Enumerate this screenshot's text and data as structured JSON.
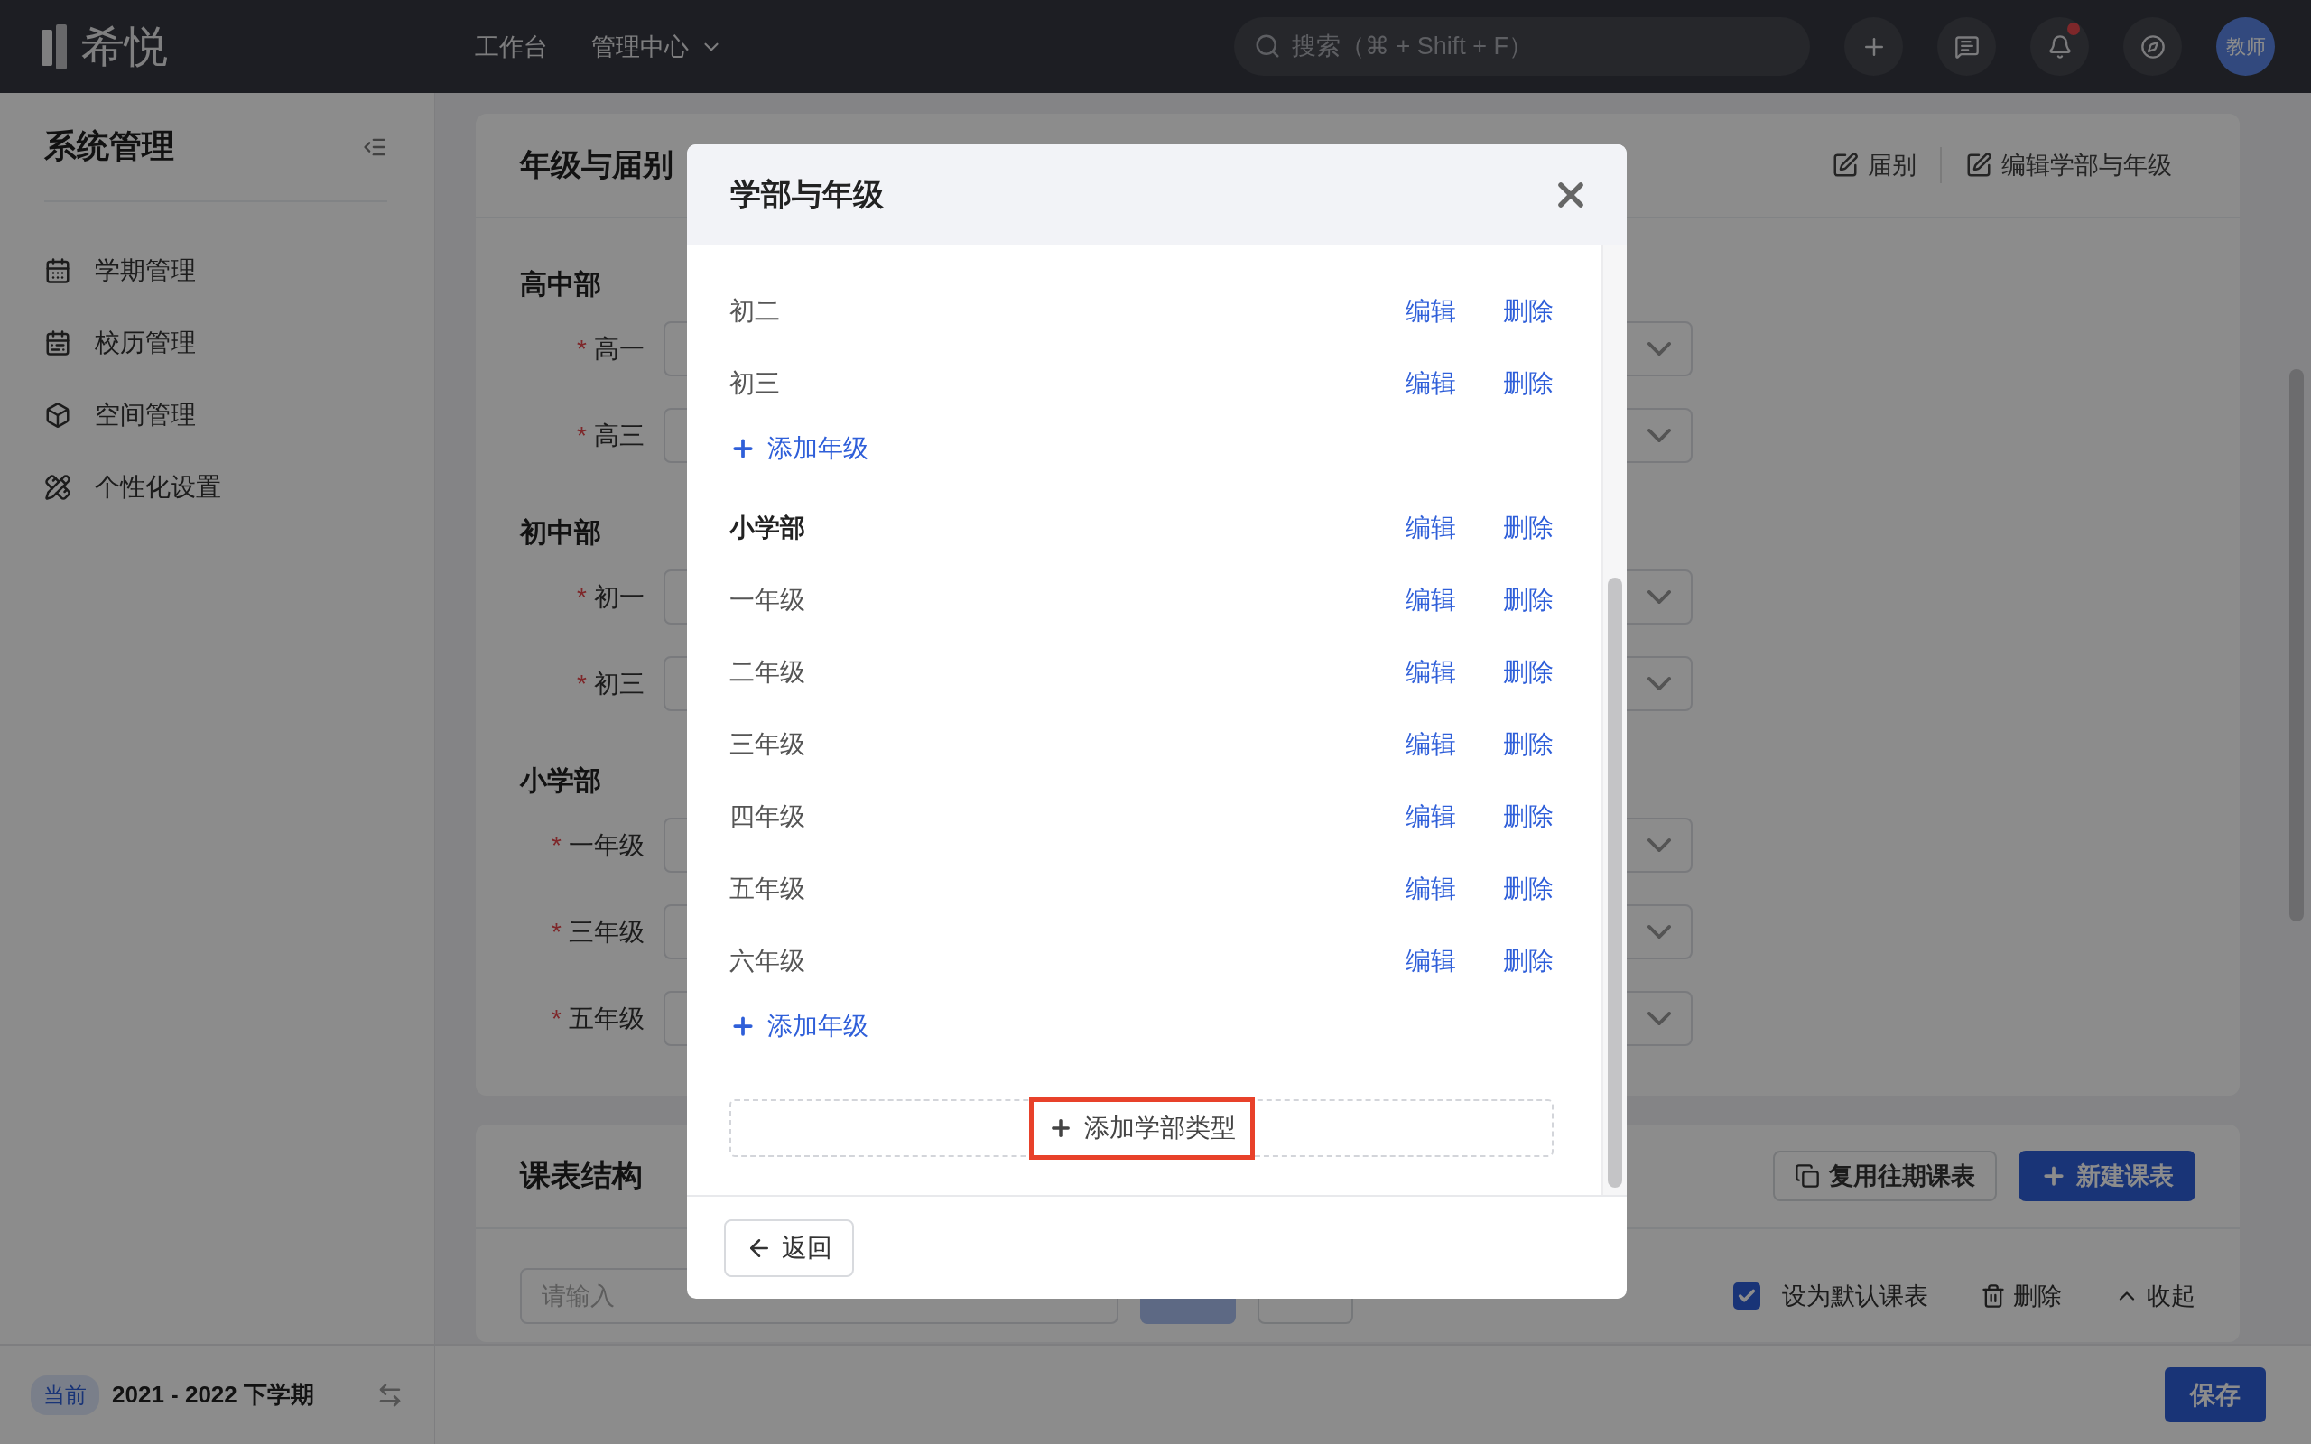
{
  "top_bar": {
    "logo": "希悦",
    "nav": [
      {
        "label": "工作台",
        "dropdown": false
      },
      {
        "label": "管理中心",
        "dropdown": true
      }
    ],
    "search": {
      "placeholder": "搜索（⌘ + Shift + F）"
    },
    "has_notification": true,
    "avatar": "教师"
  },
  "sidebar": {
    "title": "系统管理",
    "items": [
      {
        "label": "学期管理",
        "kind": "term",
        "selected": false
      },
      {
        "label": "校历管理",
        "kind": "calendar",
        "selected": false
      },
      {
        "label": "空间管理",
        "kind": "space",
        "selected": false
      },
      {
        "label": "个性化设置",
        "kind": "custom",
        "selected": false
      }
    ],
    "current_term": {
      "badge": "当前",
      "label": "2021 - 2022 下学期"
    }
  },
  "grades_card": {
    "title": "年级与届别",
    "actions": [
      "届别",
      "编辑学部与年级"
    ],
    "sections": [
      {
        "title": "高中部",
        "fields": [
          {
            "mark": "*",
            "label": "高一"
          },
          {
            "mark": "*",
            "label": "高三"
          }
        ]
      },
      {
        "title": "初中部",
        "fields": [
          {
            "mark": "*",
            "label": "初一"
          },
          {
            "mark": "*",
            "label": "初三"
          }
        ]
      },
      {
        "title": "小学部",
        "fields": [
          {
            "mark": "*",
            "label": "一年级"
          },
          {
            "mark": "*",
            "label": "三年级"
          },
          {
            "mark": "*",
            "label": "五年级"
          }
        ]
      }
    ]
  },
  "schedule_card": {
    "title": "课表结构",
    "actions": [
      {
        "label": "复用往期课表",
        "kind": "outline"
      },
      {
        "label": "新建课表",
        "kind": "primary"
      }
    ],
    "name_input": {
      "placeholder": "请输入"
    },
    "confirm": {
      "disabled": true
    },
    "default_checkbox": {
      "label": "设为默认课表",
      "checked": true
    },
    "delete": "删除",
    "collapse": "收起"
  },
  "save_button": "保存",
  "modal": {
    "title": "学部与年级",
    "rows": [
      {
        "kind": "grade",
        "label": "初二",
        "actions": [
          "编辑",
          "删除"
        ]
      },
      {
        "kind": "grade",
        "label": "初三",
        "actions": [
          "编辑",
          "删除"
        ]
      },
      {
        "kind": "add",
        "label": "添加年级"
      },
      {
        "kind": "department",
        "label": "小学部",
        "actions": [
          "编辑",
          "删除"
        ]
      },
      {
        "kind": "grade",
        "label": "一年级",
        "actions": [
          "编辑",
          "删除"
        ]
      },
      {
        "kind": "grade",
        "label": "二年级",
        "actions": [
          "编辑",
          "删除"
        ]
      },
      {
        "kind": "grade",
        "label": "三年级",
        "actions": [
          "编辑",
          "删除"
        ]
      },
      {
        "kind": "grade",
        "label": "四年级",
        "actions": [
          "编辑",
          "删除"
        ]
      },
      {
        "kind": "grade",
        "label": "五年级",
        "actions": [
          "编辑",
          "删除"
        ]
      },
      {
        "kind": "grade",
        "label": "六年级",
        "actions": [
          "编辑",
          "删除"
        ]
      },
      {
        "kind": "add",
        "label": "添加年级"
      }
    ],
    "add_department": {
      "label": "添加学部类型",
      "highlighted": true
    },
    "back": "返回"
  }
}
